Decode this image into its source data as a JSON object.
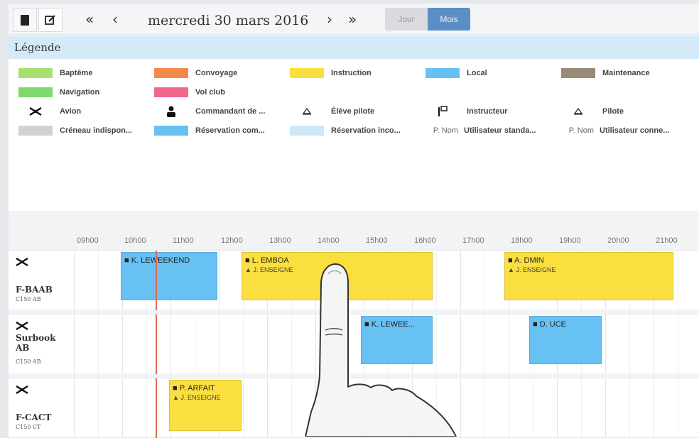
{
  "toolbar": {
    "view_icon": "book-icon",
    "edit_icon": "edit-icon",
    "prev_fast": "«",
    "prev": "‹",
    "date": "mercredi 30 mars 2016",
    "next": "›",
    "next_fast": "»",
    "day_label": "Jour",
    "month_label": "Mois",
    "active_view": "Mois"
  },
  "legend": {
    "title": "Légende",
    "items": [
      {
        "label": "Baptême",
        "color": "#a8e070",
        "kind": "swatch"
      },
      {
        "label": "Convoyage",
        "color": "#f48a4a",
        "kind": "swatch"
      },
      {
        "label": "Instruction",
        "color": "#fadf3e",
        "kind": "swatch"
      },
      {
        "label": "Local",
        "color": "#67c1f2",
        "kind": "swatch"
      },
      {
        "label": "Maintenance",
        "color": "#9a8b78",
        "kind": "swatch"
      },
      {
        "label": "Navigation",
        "color": "#7ed86e",
        "kind": "swatch"
      },
      {
        "label": "Vol club",
        "color": "#f0678a",
        "kind": "swatch"
      },
      {
        "label": "Avion",
        "icon": "airplane-icon",
        "kind": "symbol"
      },
      {
        "label": "Commandant de ...",
        "icon": "person-icon",
        "kind": "symbol"
      },
      {
        "label": "Élève pilote",
        "icon": "student-icon",
        "kind": "symbol"
      },
      {
        "label": "Instructeur",
        "icon": "instructor-icon",
        "kind": "symbol"
      },
      {
        "label": "Pilote",
        "icon": "pilot-icon",
        "kind": "symbol"
      },
      {
        "label": "Créneau indispon...",
        "color": "#d3d2cf",
        "kind": "swatch"
      },
      {
        "label": "Réservation com...",
        "color": "#67c1f2",
        "kind": "swatch"
      },
      {
        "label": "Réservation inco...",
        "color": "#cfe8f8",
        "kind": "swatch"
      },
      {
        "label": "Utilisateur standa...",
        "prefix": "P. Nom",
        "kind": "text"
      },
      {
        "label": "Utilisateur conne...",
        "prefix": "P. Nom",
        "kind": "text"
      }
    ]
  },
  "timeline": {
    "hours": [
      "09h00",
      "10h00",
      "11h00",
      "12h00",
      "13h00",
      "14h00",
      "15h00",
      "16h00",
      "17h00",
      "18h00",
      "19h00",
      "20h00",
      "21h00"
    ],
    "aircraft": [
      {
        "icon": "airplane-icon",
        "registration": "F-BAAB",
        "model": "C150 AB",
        "bookings": [
          {
            "pilot": "K. LEWEEKEND",
            "student": "",
            "type": "Local",
            "color": "#67c1f2"
          },
          {
            "pilot": "L. EMBOA",
            "student": "J. ENSEIGNE",
            "type": "Instruction",
            "color": "#fadf3e"
          },
          {
            "pilot": "A. DMIN",
            "student": "J. ENSEIGNE",
            "type": "Instruction",
            "color": "#fadf3e"
          }
        ]
      },
      {
        "icon": "airplane-icon",
        "registration": "Surbook AB",
        "model": "C150 AB",
        "bookings": [
          {
            "pilot": "K. LEWEE...",
            "student": "",
            "type": "Local",
            "color": "#67c1f2"
          },
          {
            "pilot": "D. UCE",
            "student": "",
            "type": "Local",
            "color": "#67c1f2"
          }
        ]
      },
      {
        "icon": "airplane-icon",
        "registration": "F-CACT",
        "model": "C150 CT",
        "bookings": [
          {
            "pilot": "P. ARFAIT",
            "student": "J. ENSEIGNE",
            "type": "Instruction",
            "color": "#fadf3e"
          }
        ]
      }
    ]
  }
}
